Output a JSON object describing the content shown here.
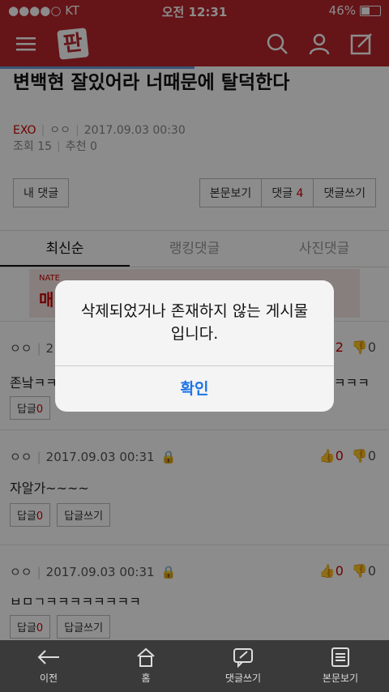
{
  "status": {
    "carrier": "●●●●○ KT",
    "time": "오전 12:31",
    "battery": "46%"
  },
  "article": {
    "title": "변백현 잘있어라 너때문에 탈덕한다",
    "category": "EXO",
    "author": "ㅇㅇ",
    "date": "2017.09.03 00:30",
    "views_label": "조회 15",
    "recommend_label": "추천 0"
  },
  "actions": {
    "my_comments": "내 댓글",
    "view_post": "본문보기",
    "comments_label": "댓글",
    "comments_count": "4",
    "write_comment": "댓글쓰기"
  },
  "tabs": [
    "최신순",
    "랭킹댓글",
    "사진댓글"
  ],
  "ad": {
    "brand": "NATE",
    "text": "매"
  },
  "comments": [
    {
      "author": "ㅇㅇ",
      "date": "2",
      "body": "존낰ㅋㅋ",
      "body_tail": "ㅋㅋㅋ",
      "likes": "2",
      "dislikes": "0",
      "reply_label": "답글",
      "reply_count": "0",
      "write_reply": "답글쓰기"
    },
    {
      "author": "ㅇㅇ",
      "date": "2017.09.03 00:31",
      "body": "자알가~~~~",
      "likes": "0",
      "dislikes": "0",
      "reply_label": "답글",
      "reply_count": "0",
      "write_reply": "답글쓰기"
    },
    {
      "author": "ㅇㅇ",
      "date": "2017.09.03 00:31",
      "body": "ㅂㅁㄱㅋㅋㅋㅋㅋㅋㅋㅋ",
      "likes": "0",
      "dislikes": "0",
      "reply_label": "답글",
      "reply_count": "0",
      "write_reply": "답글쓰기"
    }
  ],
  "dialog": {
    "message_line1": "삭제되었거나 존재하지 않는 게시물",
    "message_line2": "입니다.",
    "confirm": "확인"
  },
  "bottom_nav": [
    "이전",
    "홈",
    "댓글쓰기",
    "본문보기"
  ],
  "colors": {
    "brand": "#b8262d",
    "dialog_button": "#1a73e8",
    "bottom_bar": "#3a3a3a"
  }
}
